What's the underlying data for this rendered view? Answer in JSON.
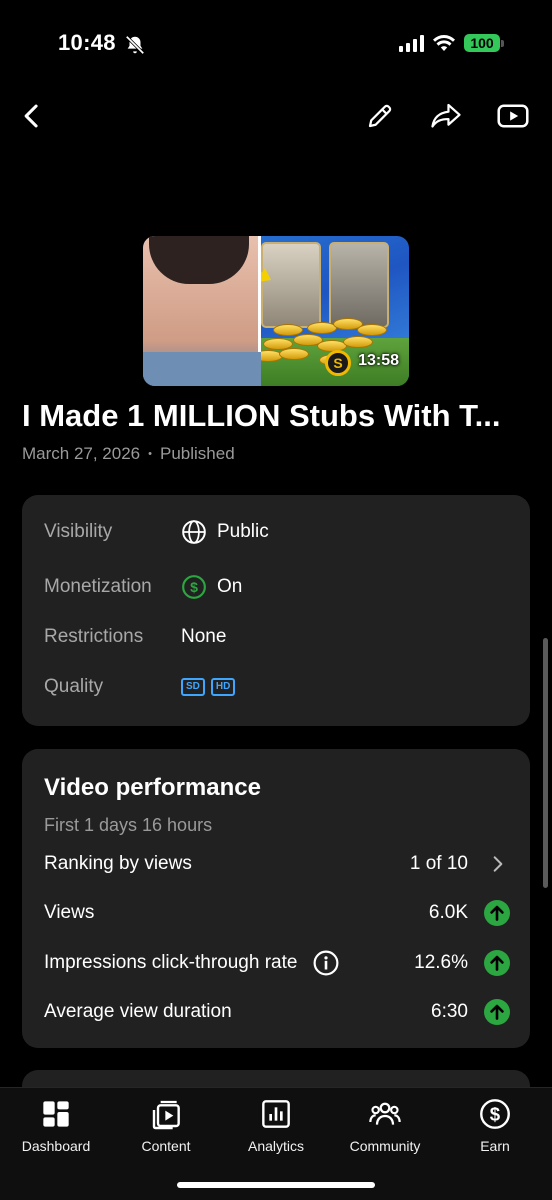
{
  "status_bar": {
    "time": "10:48",
    "battery": "100"
  },
  "top_bar": {
    "back_icon": "back-arrow-icon",
    "edit_icon": "pencil-icon",
    "share_icon": "share-icon",
    "open_icon": "youtube-icon"
  },
  "video": {
    "title": "I Made 1 MILLION Stubs With T...",
    "date": "March 27, 2026",
    "separator": "•",
    "status": "Published",
    "duration": "13:58",
    "thumbnail_logo": "S"
  },
  "details": {
    "visibility_label": "Visibility",
    "visibility_value": "Public",
    "monetization_label": "Monetization",
    "monetization_value": "On",
    "restrictions_label": "Restrictions",
    "restrictions_value": "None",
    "quality_label": "Quality",
    "quality_badges": [
      "SD",
      "HD"
    ]
  },
  "performance": {
    "title": "Video performance",
    "period": "First 1 days 16 hours",
    "rows": [
      {
        "label": "Ranking by views",
        "value": "1 of 10"
      },
      {
        "label": "Views",
        "value": "6.0K"
      },
      {
        "label": "Impressions click-through rate",
        "value": "12.6%"
      },
      {
        "label": "Average view duration",
        "value": "6:30"
      }
    ]
  },
  "nav": {
    "items": [
      {
        "label": "Dashboard",
        "icon": "dashboard-icon"
      },
      {
        "label": "Content",
        "icon": "content-icon"
      },
      {
        "label": "Analytics",
        "icon": "analytics-icon"
      },
      {
        "label": "Community",
        "icon": "community-icon"
      },
      {
        "label": "Earn",
        "icon": "earn-icon"
      }
    ]
  },
  "colors": {
    "background": "#000000",
    "card": "#212121",
    "accent_green": "#2ba640",
    "accent_blue": "#3ea6ff"
  }
}
